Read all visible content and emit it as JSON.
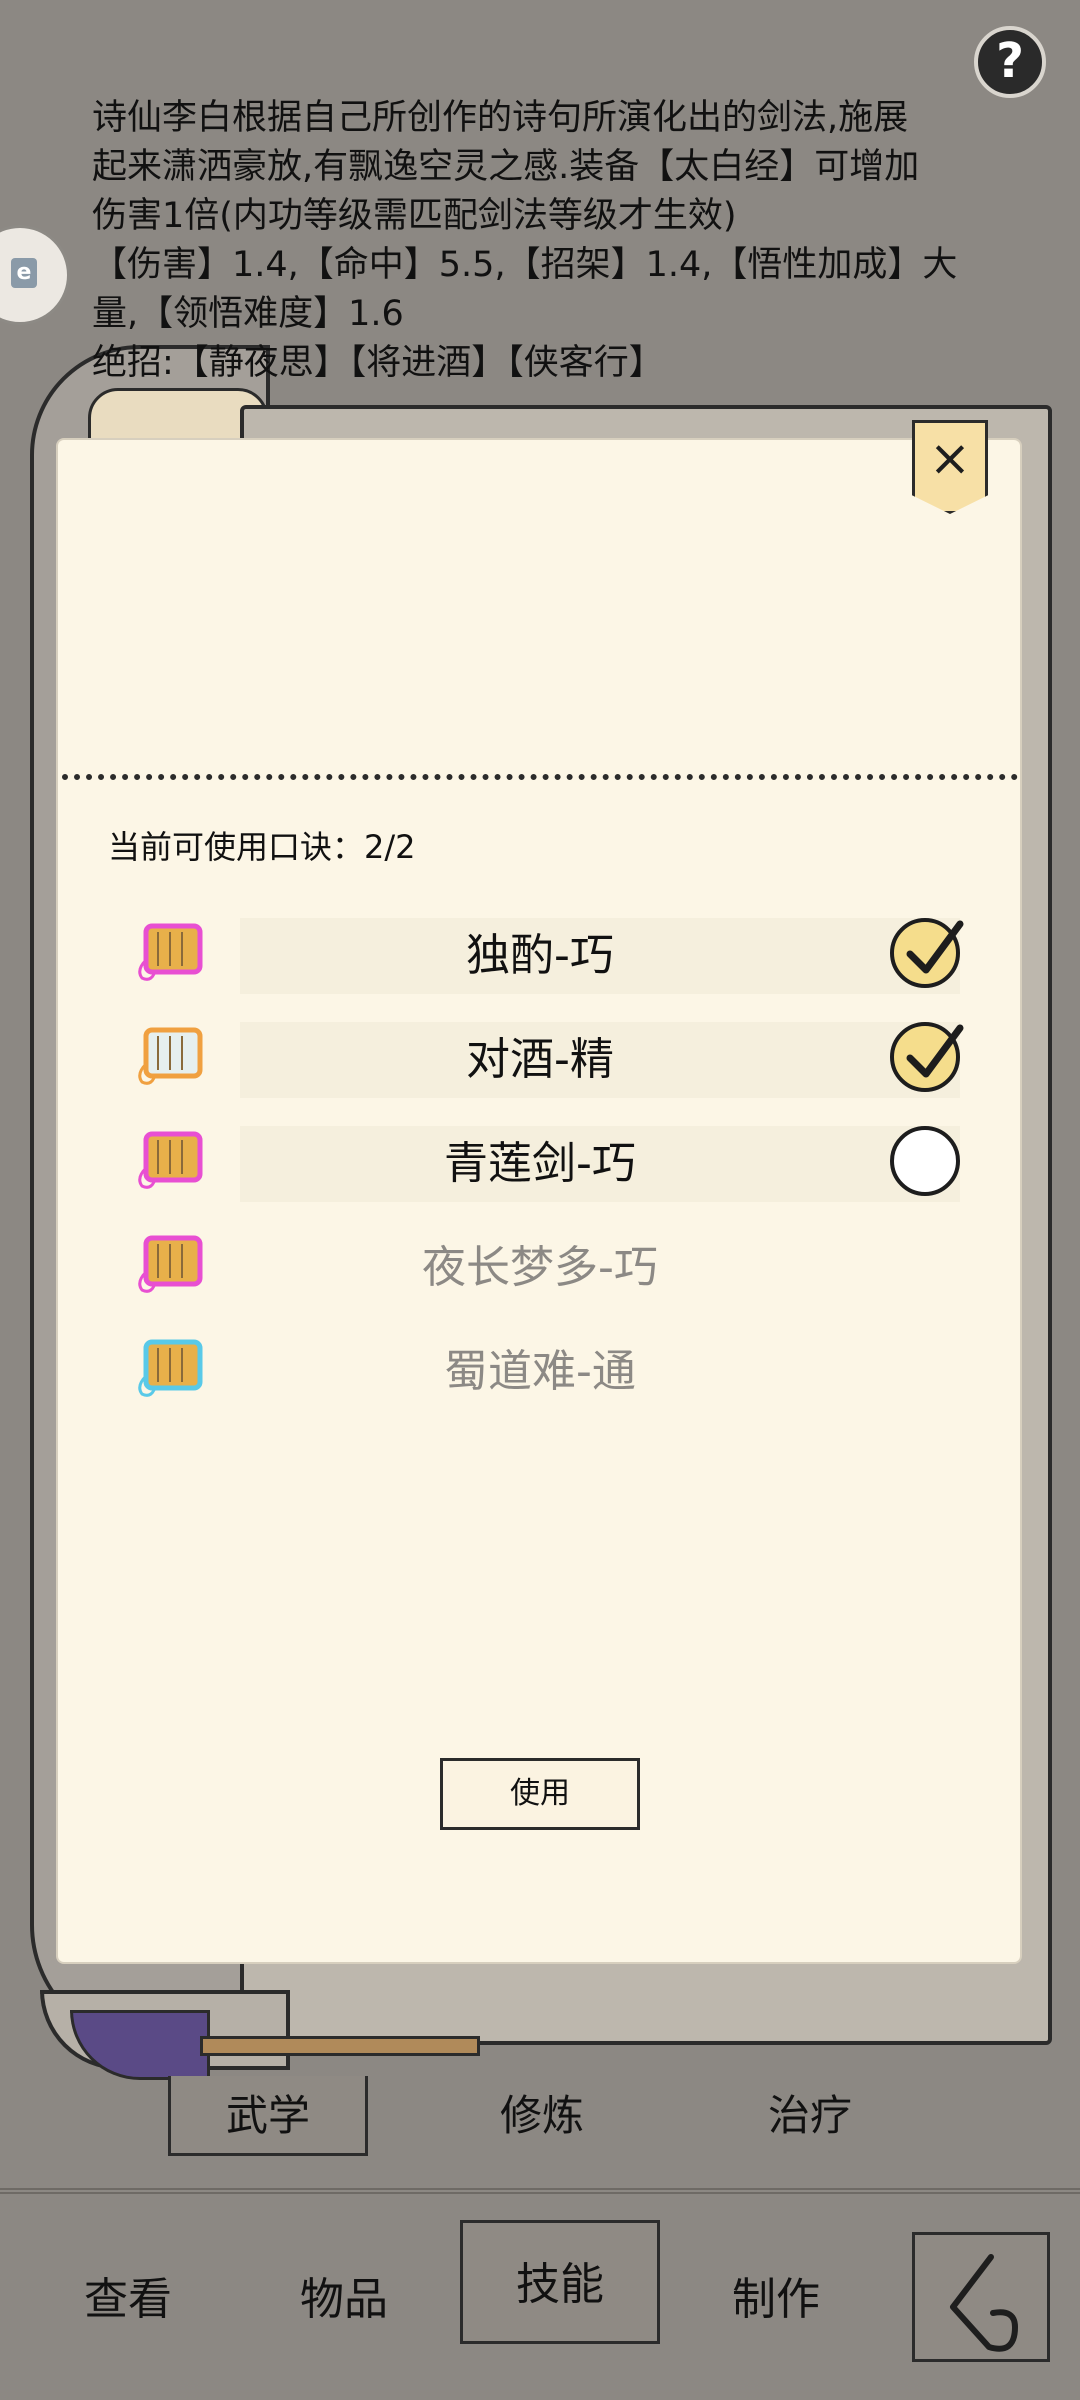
{
  "help_label": "?",
  "description": {
    "lines": [
      "诗仙李白根据自己所创作的诗句所演化出的剑法,施展",
      "起来潇洒豪放,有飘逸空灵之感.装备【太白经】可增加",
      "伤害1倍(内功等级需匹配剑法等级才生效)",
      "【伤害】1.4,【命中】5.5,【招架】1.4,【悟性加成】大",
      "量,【领悟难度】1.6",
      "绝招:【静夜思】【将进酒】【侠客行】"
    ]
  },
  "badge_mark": "e",
  "modal": {
    "close_label": "×",
    "count_label": "当前可使用口诀：2/2",
    "use_button": "使用",
    "items": [
      {
        "name": "独酌-巧",
        "checked": true,
        "enabled": true,
        "icon": "scroll-gold-pink-icon"
      },
      {
        "name": "对酒-精",
        "checked": true,
        "enabled": true,
        "icon": "scroll-white-orange-icon"
      },
      {
        "name": "青莲剑-巧",
        "checked": false,
        "enabled": true,
        "icon": "scroll-gold-pink-icon"
      },
      {
        "name": "夜长梦多-巧",
        "checked": false,
        "enabled": false,
        "icon": "scroll-gold-pink-icon"
      },
      {
        "name": "蜀道难-通",
        "checked": false,
        "enabled": false,
        "icon": "scroll-gold-cyan-icon"
      }
    ]
  },
  "subtabs": [
    "武学",
    "修炼",
    "治疗"
  ],
  "nav": [
    "查看",
    "物品",
    "技能",
    "制作"
  ],
  "colors": {
    "background": "#8c8883",
    "panel": "#fcf6e6",
    "check_fill": "#f5dd8c",
    "scroll_gold": "#e8b04a",
    "glow_pink": "#e84fd2",
    "glow_cyan": "#59c9e8"
  }
}
